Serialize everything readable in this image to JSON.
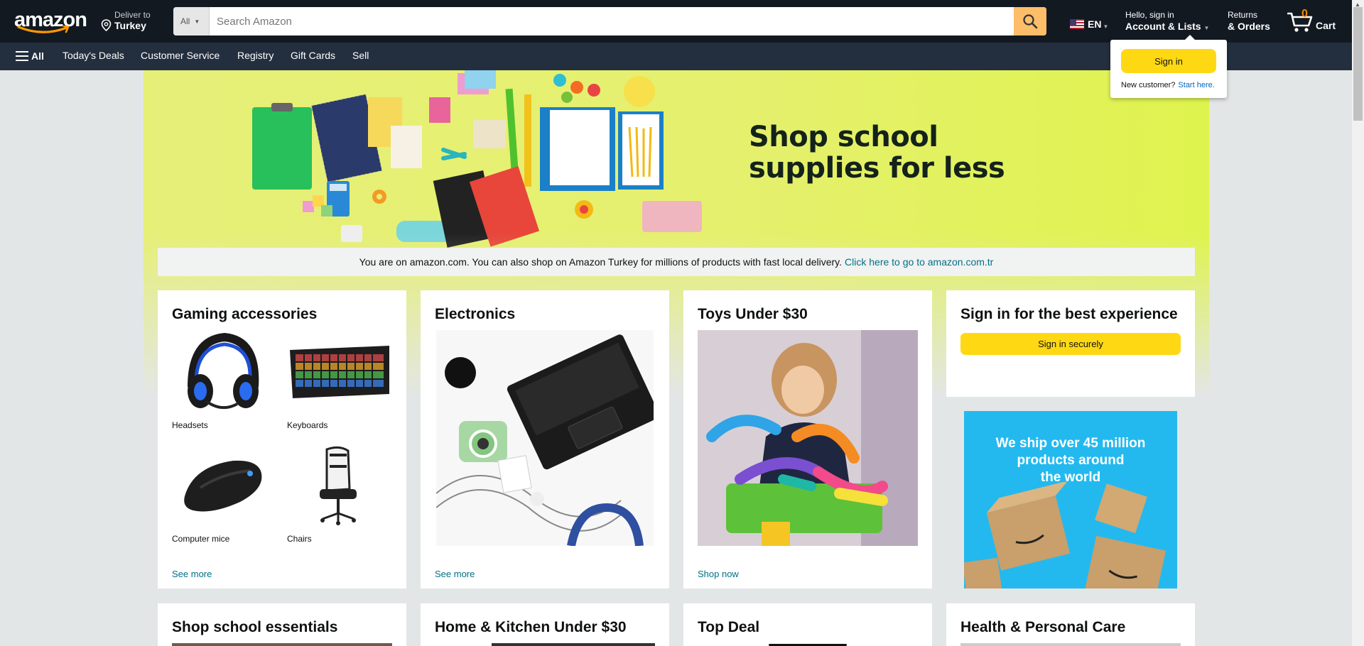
{
  "header": {
    "logo_text": "amazon",
    "deliver_line1": "Deliver to",
    "deliver_line2": "Turkey",
    "search_category": "All",
    "search_placeholder": "Search Amazon",
    "language": "EN",
    "account_line1": "Hello, sign in",
    "account_line2": "Account & Lists",
    "returns_line1": "Returns",
    "returns_line2": "& Orders",
    "cart_count": "0",
    "cart_label": "Cart"
  },
  "subnav": {
    "all_label": "All",
    "items": [
      "Today's Deals",
      "Customer Service",
      "Registry",
      "Gift Cards",
      "Sell"
    ]
  },
  "flyout": {
    "signin_button": "Sign in",
    "new_customer": "New customer?",
    "start_here": "Start here."
  },
  "hero": {
    "title_line1": "Shop school",
    "title_line2": "supplies for less"
  },
  "notice": {
    "text": "You are on amazon.com. You can also shop on Amazon Turkey for millions of products with fast local delivery.",
    "link": "Click here to go to amazon.com.tr"
  },
  "cards": {
    "gaming": {
      "title": "Gaming accessories",
      "items": [
        "Headsets",
        "Keyboards",
        "Computer mice",
        "Chairs"
      ],
      "link": "See more"
    },
    "electronics": {
      "title": "Electronics",
      "link": "See more"
    },
    "toys": {
      "title": "Toys Under $30",
      "link": "Shop now"
    },
    "signin": {
      "title": "Sign in for the best experience",
      "button": "Sign in securely"
    },
    "ship_ad": {
      "line1": "We ship over 45 million",
      "line2": "products around",
      "line3": "the world"
    },
    "row2": [
      "Shop school essentials",
      "Home & Kitchen Under $30",
      "Top Deal",
      "Health & Personal Care"
    ]
  },
  "colors": {
    "nav_dark": "#131921",
    "nav_secondary": "#232f3e",
    "search_button": "#febd69",
    "signin_button": "#ffd814",
    "link": "#007185",
    "cart_count": "#f08804",
    "ship_ad_bg": "#23b9ef"
  }
}
